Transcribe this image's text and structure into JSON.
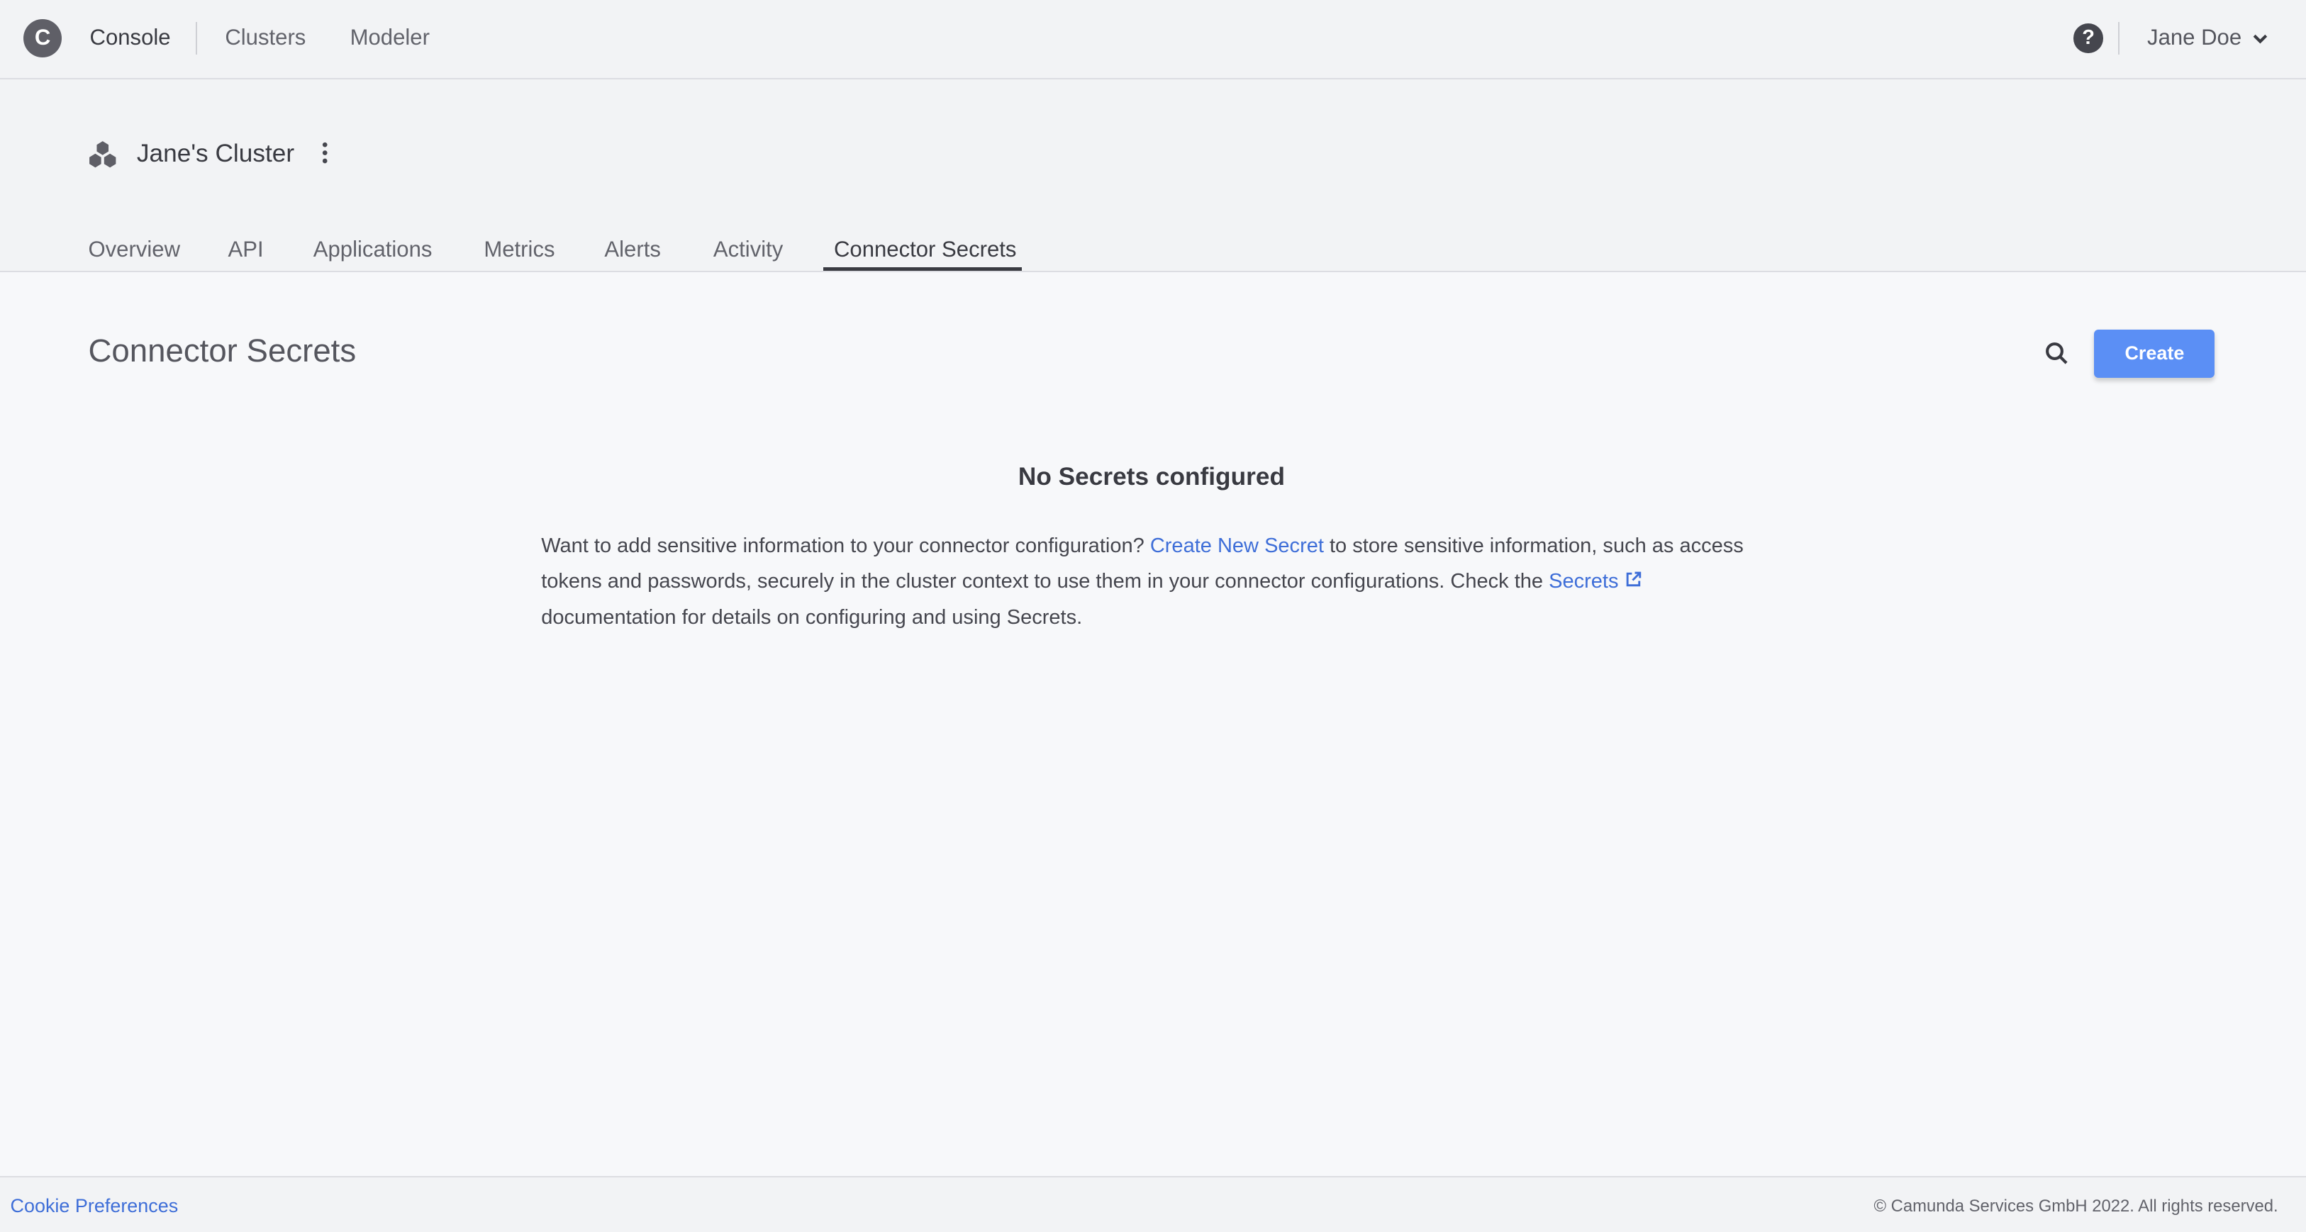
{
  "topbar": {
    "logo_letter": "C",
    "app_name": "Console",
    "nav": [
      "Clusters",
      "Modeler"
    ],
    "help_icon": "?",
    "user_name": "Jane Doe"
  },
  "cluster": {
    "name": "Jane's Cluster",
    "tabs": [
      "Overview",
      "API",
      "Applications",
      "Metrics",
      "Alerts",
      "Activity",
      "Connector Secrets"
    ],
    "active_tab": "Connector Secrets"
  },
  "main": {
    "title": "Connector Secrets",
    "create_label": "Create",
    "empty_title": "No Secrets configured",
    "para_1": "Want to add sensitive information to your connector configuration? ",
    "link_create": "Create New Secret",
    "para_2": " to store sensitive information, such as access tokens and passwords, securely in the cluster context to use them in your connector configurations. Check the ",
    "link_secrets": "Secrets",
    "para_3": " documentation for details on configuring and using Secrets."
  },
  "footer": {
    "cookie": "Cookie Preferences",
    "copyright": "© Camunda Services GmbH 2022. All rights reserved."
  },
  "colors": {
    "accent": "#5b8ff5",
    "link": "#3e6ed8"
  }
}
